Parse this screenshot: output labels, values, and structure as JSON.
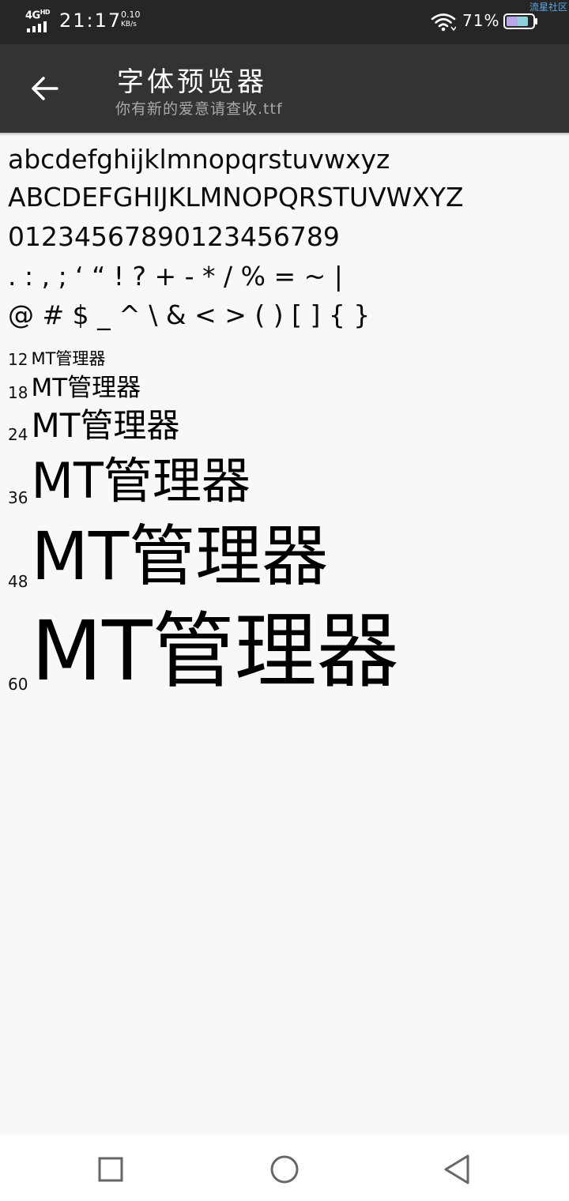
{
  "status_bar": {
    "network": "4G",
    "network_sup": "HD",
    "time": "21:17",
    "speed_value": "0.10",
    "speed_unit": "KB/s",
    "battery_percent": "71%",
    "watermark": "流星社区"
  },
  "app_bar": {
    "title": "字体预览器",
    "subtitle": "你有新的爱意请查收.ttf",
    "back_icon": "arrow-back-icon"
  },
  "preview": {
    "lowercase": "abcdefghijklmnopqrstuvwxyz",
    "uppercase": "ABCDEFGHIJKLMNOPQRSTUVWXYZ",
    "digits": "01234567890123456789",
    "punctuation": ". : , ; ‘ “ ! ? + - * / % = ~ |",
    "symbols": "@ # $ _ ^ \\ & < > ( ) [ ] { }",
    "sizes": [
      {
        "size": "12",
        "text": "MT管理器"
      },
      {
        "size": "18",
        "text": "MT管理器"
      },
      {
        "size": "24",
        "text": "MT管理器"
      },
      {
        "size": "36",
        "text": "MT管理器"
      },
      {
        "size": "48",
        "text": "MT管理器"
      },
      {
        "size": "60",
        "text": "MT管理器"
      }
    ]
  },
  "nav_bar": {
    "recents_icon": "square-icon",
    "home_icon": "circle-icon",
    "back_icon": "triangle-back-icon"
  },
  "colors": {
    "status_bar_bg": "#262626",
    "app_bar_bg": "#333333",
    "page_bg": "#f8f8f8",
    "subtitle": "#a9a9a9"
  }
}
